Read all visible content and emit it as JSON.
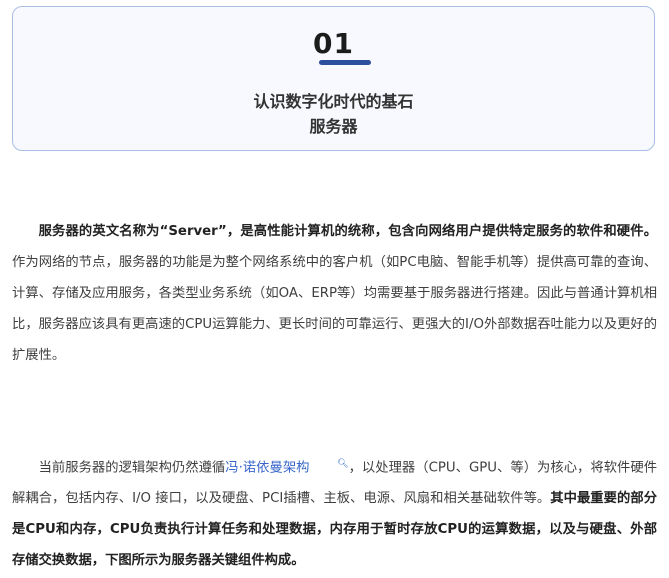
{
  "header": {
    "number": "01",
    "title_line1": "认识数字化时代的基石",
    "title_line2": "服务器"
  },
  "paragraph1": {
    "bold": "服务器的英文名称为“Server”，是高性能计算机的统称，包含向网络用户提供特定服务的软件和硬件。",
    "text": "作为网络的节点，服务器的功能是为整个网络系统中的客户机（如PC电脑、智能手机等）提供高可靠的查询、计算、存储及应用服务，各类型业务系统（如OA、ERP等）均需要基于服务器进行搭建。因此与普通计算机相比，服务器应该具有更高速的CPU运算能力、更长时间的可靠运行、更强大的I/O外部数据吞吐能力以及更好的扩展性。"
  },
  "paragraph2": {
    "text_before_link": "当前服务器的逻辑架构仍然遵循",
    "link": "冯·诺依曼架构",
    "link_icon": "search-icon",
    "text_after_link": "，以处理器（CPU、GPU、等）为核心，将软件硬件解耦合，包括内存、I/O 接口，以及硬盘、PCI插槽、主板、电源、风扇和相关基础软件等。",
    "bold": "其中最重要的部分是CPU和内存，CPU负责执行计算任务和处理数据，内存用于暂时存放CPU的运算数据，以及与硬盘、外部存储交换数据，下图所示为服务器关键组件构成。"
  },
  "colors": {
    "accent_bar": "#2c4f9e",
    "card_border": "#a9bfe4",
    "card_background": "#f7f9fe",
    "link": "#3866c8"
  }
}
